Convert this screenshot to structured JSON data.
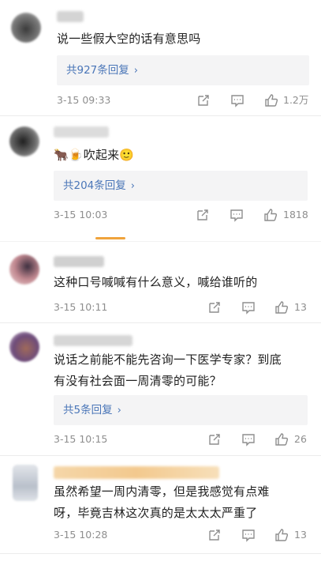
{
  "comments": [
    {
      "text": "说一些假大空的话有意思吗",
      "reply_label": "共927条回复",
      "time": "3-15 09:33",
      "likes": "1.2万"
    },
    {
      "text": "🐂🍺吹起来🙂",
      "reply_label": "共204条回复",
      "time": "3-15 10:03",
      "likes": "1818"
    },
    {
      "text": "这种口号喊喊有什么意义，喊给谁听的",
      "reply_label": "",
      "time": "3-15 10:11",
      "likes": "13"
    },
    {
      "text": "说话之前能不能先咨询一下医学专家？到底\n有没有社会面一周清零的可能？",
      "reply_label": "共5条回复",
      "time": "3-15 10:15",
      "likes": "26"
    },
    {
      "text": "虽然希望一周内清零，但是我感觉有点难\n呀，毕竟吉林这次真的是太太太严重了",
      "reply_label": "",
      "time": "3-15 10:28",
      "likes": "13"
    }
  ],
  "colors": {
    "link": "#4a76b8",
    "muted": "#8e8e8e",
    "reply_bg": "#f4f4f5",
    "accent": "#f0a33c"
  },
  "icons": [
    "share-icon",
    "comment-icon",
    "like-icon",
    "chevron-right-icon"
  ]
}
